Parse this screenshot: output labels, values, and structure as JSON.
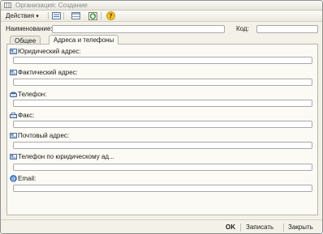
{
  "window": {
    "title": "Организация: Создание"
  },
  "toolbar": {
    "actions_label": "Действия",
    "actions_arrow": "▾"
  },
  "header": {
    "name_label": "Наименование:",
    "name_value": "",
    "code_label": "Код:",
    "code_value": ""
  },
  "tabs": [
    {
      "label": "Общее"
    },
    {
      "label": "Адреса и телефоны"
    }
  ],
  "contacts": {
    "fields": [
      {
        "label": "Юридический адрес:",
        "icon": "address-icon",
        "value": ""
      },
      {
        "label": "Фактический адрес:",
        "icon": "address-icon",
        "value": ""
      },
      {
        "label": "Телефон:",
        "icon": "phone-icon",
        "value": ""
      },
      {
        "label": "Факс:",
        "icon": "fax-icon",
        "value": ""
      },
      {
        "label": "Почтовый адрес:",
        "icon": "address-icon",
        "value": ""
      },
      {
        "label": "Телефон по юридическому ад...",
        "icon": "address-icon",
        "value": ""
      },
      {
        "label": "Email:",
        "icon": "email-icon",
        "value": ""
      }
    ]
  },
  "footer": {
    "ok_label": "OK",
    "save_label": "Записать",
    "close_label": "Закрыть"
  }
}
